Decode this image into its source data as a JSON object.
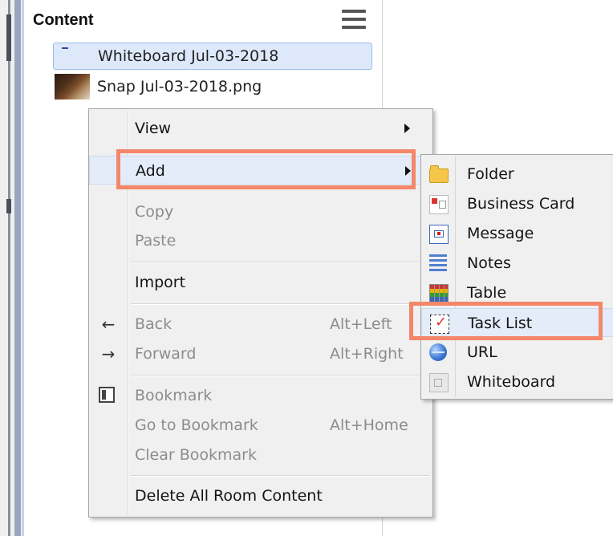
{
  "panel": {
    "title": "Content"
  },
  "tree": {
    "items": [
      {
        "label": "Whiteboard Jul-03-2018",
        "icon": "whiteboard-icon",
        "selected": true
      },
      {
        "label": "Snap Jul-03-2018.png",
        "icon": "image-thumbnail-icon",
        "selected": false
      }
    ]
  },
  "context_menu": {
    "view": "View",
    "add": "Add",
    "copy": "Copy",
    "paste": "Paste",
    "import": "Import",
    "back": "Back",
    "back_shortcut": "Alt+Left",
    "forward": "Forward",
    "forward_shortcut": "Alt+Right",
    "bookmark": "Bookmark",
    "goto_bookmark": "Go to Bookmark",
    "goto_bookmark_shortcut": "Alt+Home",
    "clear_bookmark": "Clear Bookmark",
    "delete_all": "Delete All Room Content",
    "back_icon": "←",
    "forward_icon": "→"
  },
  "add_submenu": {
    "folder": "Folder",
    "business_card": "Business Card",
    "message": "Message",
    "notes": "Notes",
    "table": "Table",
    "task_list": "Task List",
    "url": "URL",
    "whiteboard": "Whiteboard"
  },
  "colors": {
    "highlight": "#f4876a",
    "selection": "#dde9fb",
    "menu_bg": "#f0f0f0"
  }
}
